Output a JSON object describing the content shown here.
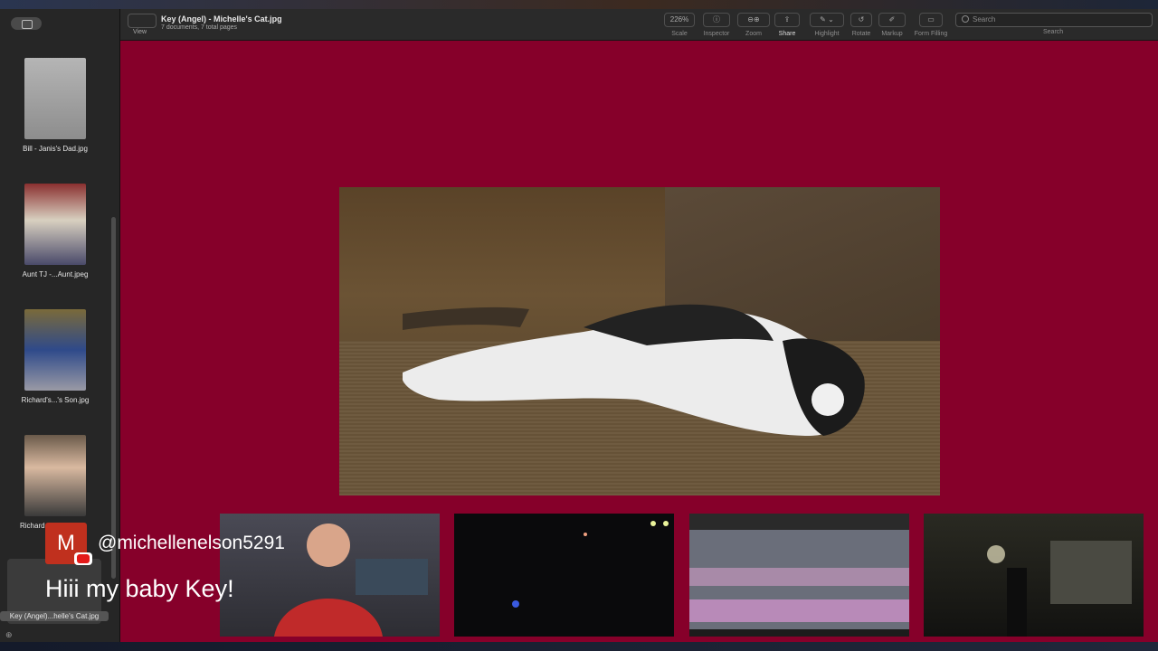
{
  "window": {
    "title": "Key (Angel) - Michelle's Cat.jpg",
    "subtitle": "7 documents, 7 total pages"
  },
  "toolbar": {
    "view_label": "View",
    "zoom_value": "226%",
    "scale_label": "Scale",
    "inspector_label": "Inspector",
    "zoom_label": "Zoom",
    "share_label": "Share",
    "highlight_label": "Highlight",
    "rotate_label": "Rotate",
    "markup_label": "Markup",
    "form_label": "Form Filling",
    "search_placeholder": "Search",
    "search_label": "Search"
  },
  "sidebar": {
    "items": [
      {
        "label": "Bill - Janis's Dad.jpg",
        "color": "#9a9a9a"
      },
      {
        "label": "Aunt TJ -...Aunt.jpeg",
        "color": "#7a5a55"
      },
      {
        "label": "Richard's...'s Son.jpg",
        "color": "#3b4f78"
      },
      {
        "label": "Richard",
        "color": "#5b4a3a"
      }
    ],
    "selected_label": "Key (Angel)...helle's Cat.jpg"
  },
  "chat": {
    "avatar_letter": "M",
    "username": "@michellenelson5291",
    "message": "Hiii my baby Key!"
  },
  "colors": {
    "canvas": "#86002a",
    "avatar": "#c0301e"
  }
}
